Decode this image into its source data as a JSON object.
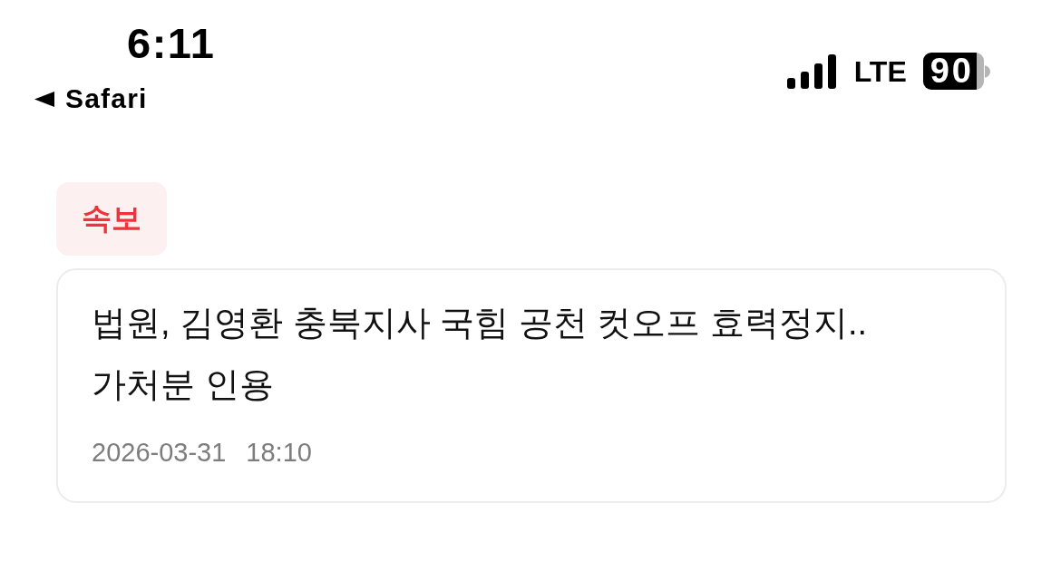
{
  "status_bar": {
    "time": "6:11",
    "back_label": "Safari",
    "network": "LTE",
    "battery": "90"
  },
  "badge": {
    "label": "속보"
  },
  "article": {
    "headline": "법원, 김영환 충북지사 국힘 공천 컷오프 효력정지.. 가처분 인용",
    "date": "2026-03-31",
    "time": "18:10"
  }
}
